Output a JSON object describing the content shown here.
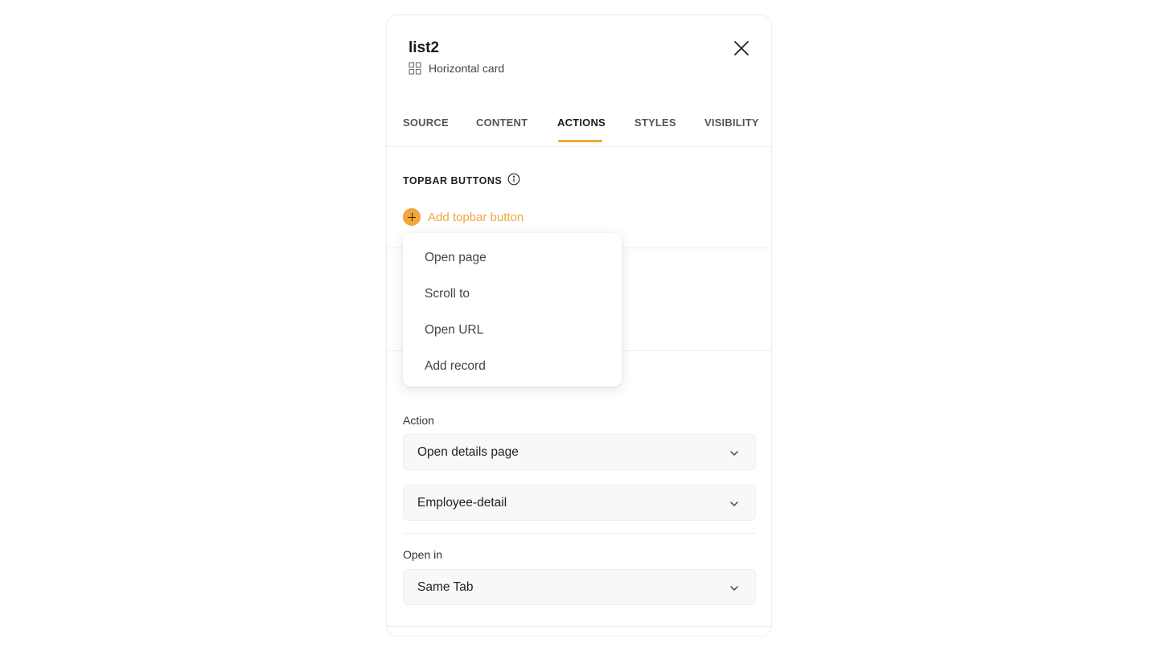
{
  "header": {
    "title": "list2",
    "subtitle": "Horizontal card",
    "subtitle_icon": "grid-icon",
    "close_icon": "close-icon"
  },
  "tabs": [
    {
      "label": "SOURCE",
      "active": false
    },
    {
      "label": "CONTENT",
      "active": false
    },
    {
      "label": "ACTIONS",
      "active": true
    },
    {
      "label": "STYLES",
      "active": false
    },
    {
      "label": "VISIBILITY",
      "active": false
    }
  ],
  "topbar": {
    "heading": "TOPBAR BUTTONS",
    "info_icon": "info-icon",
    "add_label": "Add topbar button"
  },
  "dropdown": {
    "items": [
      "Open page",
      "Scroll to",
      "Open URL",
      "Add record"
    ]
  },
  "action": {
    "label": "Action",
    "value": "Open details page",
    "page_value": "Employee-detail"
  },
  "open_in": {
    "label": "Open in",
    "value": "Same Tab"
  },
  "colors": {
    "accent": "#f0a73a",
    "border": "#ececec",
    "field_bg": "#f8f8f8"
  }
}
